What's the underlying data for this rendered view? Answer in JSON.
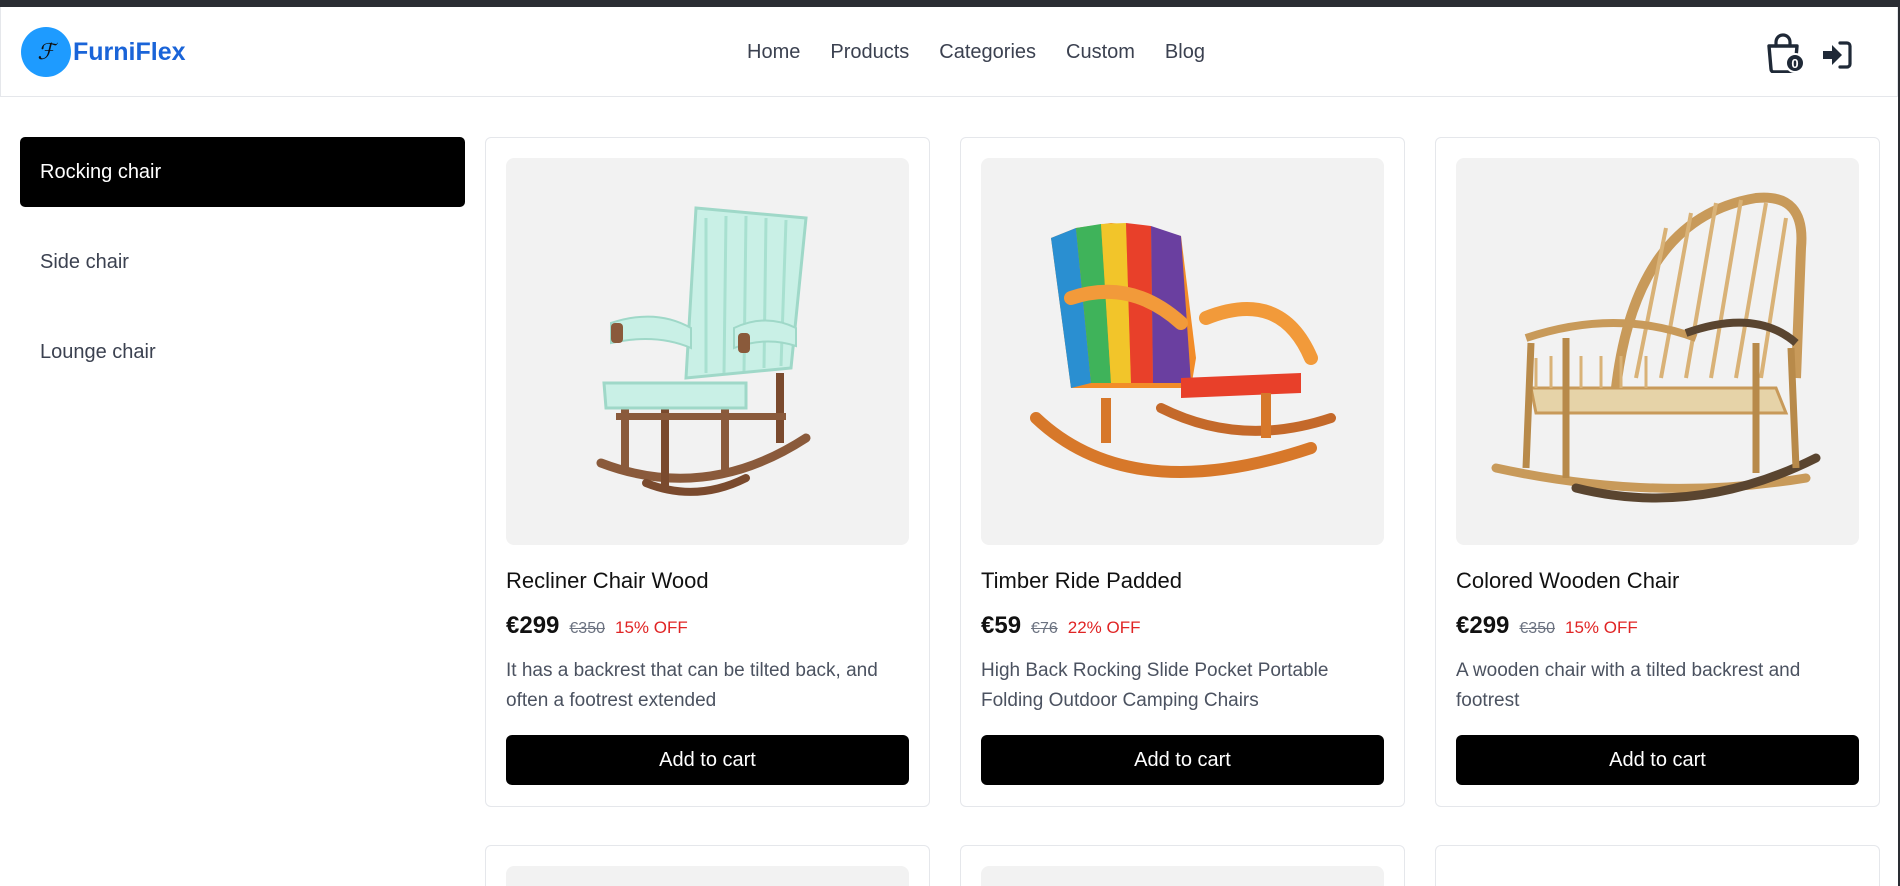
{
  "header": {
    "logo_mark": "ℱ",
    "logo_text": "FurniFlex",
    "nav": [
      "Home",
      "Products",
      "Categories",
      "Custom",
      "Blog"
    ],
    "cart_count": "0",
    "icons": {
      "cart": "shopping-bag-icon",
      "login": "sign-in-icon"
    }
  },
  "sidebar": {
    "items": [
      {
        "label": "Rocking chair",
        "active": true
      },
      {
        "label": "Side chair",
        "active": false
      },
      {
        "label": "Lounge chair",
        "active": false
      }
    ]
  },
  "products": [
    {
      "title": "Recliner Chair Wood",
      "price": "€299",
      "old_price": "€350",
      "discount": "15% OFF",
      "description": "It has a backrest that can be tilted back, and often a footrest extended",
      "button": "Add to cart"
    },
    {
      "title": "Timber Ride Padded",
      "price": "€59",
      "old_price": "€76",
      "discount": "22% OFF",
      "description": "High Back Rocking Slide Pocket Portable Folding Outdoor Camping Chairs",
      "button": "Add to cart"
    },
    {
      "title": "Colored Wooden Chair",
      "price": "€299",
      "old_price": "€350",
      "discount": "15% OFF",
      "description": "A wooden chair with a tilted backrest and footrest",
      "button": "Add to cart"
    }
  ],
  "colors": {
    "brand": "#1a64d8",
    "logo_circle": "#1e9bff",
    "discount": "#e02424",
    "button_bg": "#000000"
  }
}
